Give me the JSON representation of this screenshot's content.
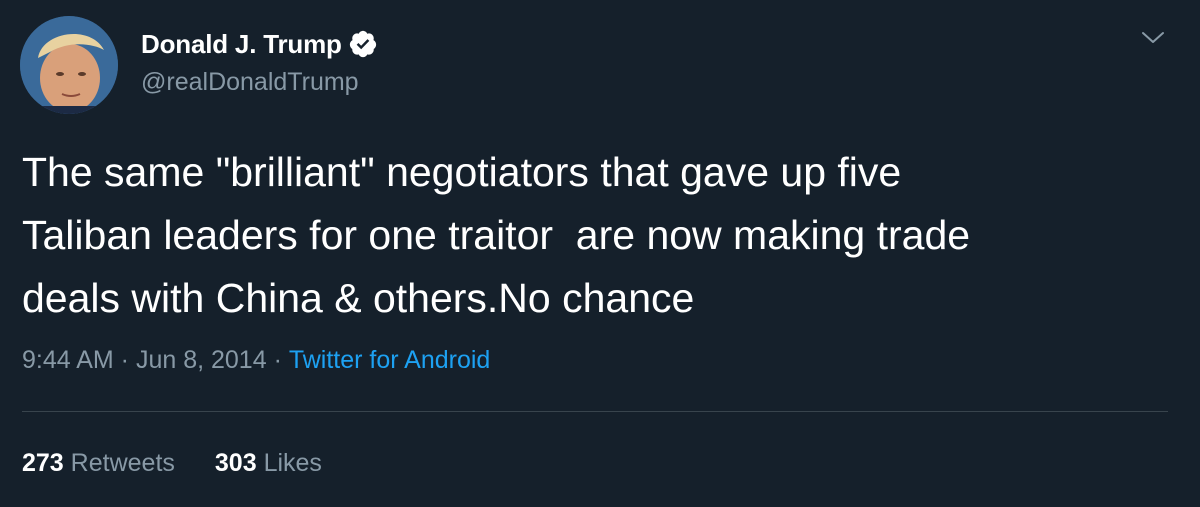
{
  "author": {
    "name": "Donald J. Trump",
    "handle": "@realDonaldTrump",
    "verified": true,
    "avatar_icon": "profile-photo"
  },
  "tweet": {
    "text": "The same \"brilliant\" negotiators that gave up five\nTaliban leaders for one traitor  are now making trade\ndeals with China & others.No chance"
  },
  "meta": {
    "time": "9:44 AM",
    "separator": " · ",
    "date": "Jun 8, 2014",
    "source": "Twitter for Android"
  },
  "stats": {
    "retweets_count": "273",
    "retweets_label": "Retweets",
    "likes_count": "303",
    "likes_label": "Likes"
  },
  "icons": {
    "verified": "verified-badge-icon",
    "menu": "chevron-down-icon"
  },
  "colors": {
    "background": "#15202b",
    "primary_text": "#ffffff",
    "secondary_text": "#8899a6",
    "link": "#1da1f2",
    "divider": "#38444d"
  }
}
